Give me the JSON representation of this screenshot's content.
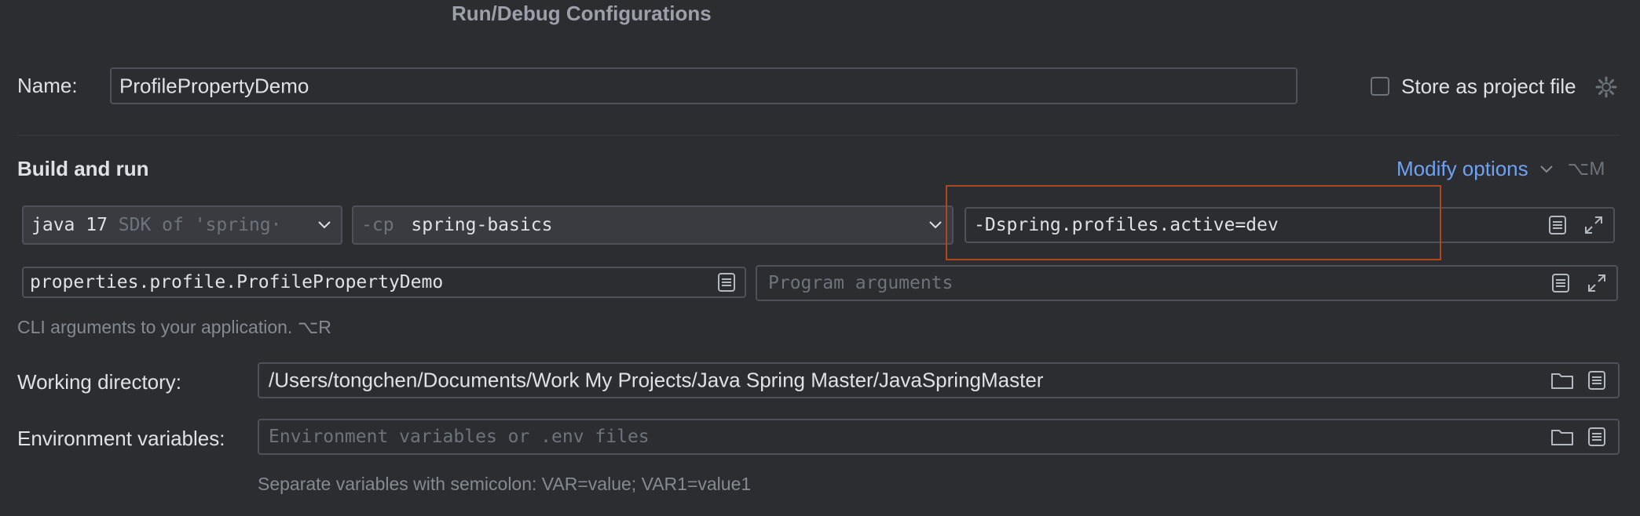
{
  "dialog": {
    "title": "Run/Debug Configurations"
  },
  "name_row": {
    "label": "Name:",
    "value": "ProfilePropertyDemo",
    "store_label": "Store as project file"
  },
  "build_run": {
    "heading": "Build and run",
    "modify_label": "Modify options",
    "modify_shortcut": "⌥M",
    "jdk_main": "java 17",
    "jdk_detail": "SDK of 'spring·",
    "cp_prefix": "-cp",
    "cp_value": "spring-basics",
    "vm_options": "-Dspring.profiles.active=dev",
    "main_class": "properties.profile.ProfilePropertyDemo",
    "program_args_placeholder": "Program arguments",
    "cli_hint": "CLI arguments to your application. ⌥R"
  },
  "working_dir": {
    "label": "Working directory:",
    "value": "/Users/tongchen/Documents/Work My Projects/Java Spring Master/JavaSpringMaster"
  },
  "env_vars": {
    "label": "Environment variables:",
    "placeholder": "Environment variables or .env files",
    "hint": "Separate variables with semicolon: VAR=value; VAR1=value1"
  },
  "colors": {
    "background": "#2b2d30",
    "accent_link": "#6ea2f5",
    "highlight_box": "#b0461f"
  },
  "icons": [
    "gear-icon",
    "chevron-down-icon",
    "list-icon",
    "expand-icon",
    "folder-icon"
  ]
}
